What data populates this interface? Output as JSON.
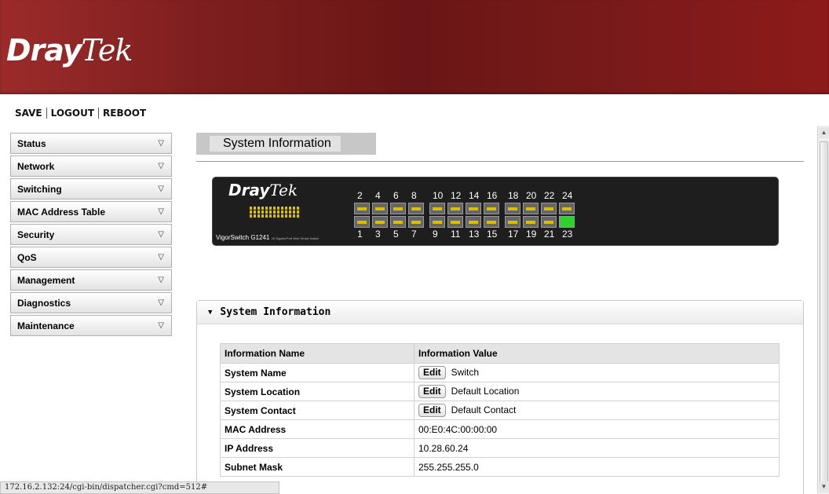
{
  "header": {
    "brand_bold": "Dray",
    "brand_italic": "Tek"
  },
  "toplinks": {
    "save": "SAVE",
    "logout": "LOGOUT",
    "reboot": "REBOOT"
  },
  "menu": [
    {
      "label": "Status"
    },
    {
      "label": "Network"
    },
    {
      "label": "Switching"
    },
    {
      "label": "MAC Address Table"
    },
    {
      "label": "Security"
    },
    {
      "label": "QoS"
    },
    {
      "label": "Management"
    },
    {
      "label": "Diagnostics"
    },
    {
      "label": "Maintenance"
    }
  ],
  "page_title": "System Information",
  "device": {
    "brand_bold": "Dray",
    "brand_italic": "Tek",
    "model": "VigorSwitch G1241",
    "model_sub": "24 Gigabit Port Web Smart Switch",
    "top_ports": [
      "2",
      "4",
      "6",
      "8",
      "10",
      "12",
      "14",
      "16",
      "18",
      "20",
      "22",
      "24"
    ],
    "bottom_ports": [
      "1",
      "3",
      "5",
      "7",
      "9",
      "11",
      "13",
      "15",
      "17",
      "19",
      "21",
      "23"
    ],
    "active_port": "23"
  },
  "panel": {
    "title": "System Information"
  },
  "table": {
    "col_name": "Information Name",
    "col_value": "Information Value",
    "edit_label": "Edit",
    "rows": [
      {
        "name": "System Name",
        "value": "Switch",
        "editable": true
      },
      {
        "name": "System Location",
        "value": "Default Location",
        "editable": true
      },
      {
        "name": "System Contact",
        "value": "Default Contact",
        "editable": true
      },
      {
        "name": "MAC Address",
        "value": "00:E0:4C:00:00:00",
        "editable": false
      },
      {
        "name": "IP Address",
        "value": "10.28.60.24",
        "editable": false
      },
      {
        "name": "Subnet Mask",
        "value": "255.255.255.0",
        "editable": false
      }
    ]
  },
  "statusbar": {
    "url": "172.16.2.132:24/cgi-bin/dispatcher.cgi?cmd=512#"
  },
  "colors": {
    "banner": "#7e1e1e",
    "port_active": "#2fd12f",
    "port_led": "#d8c000"
  }
}
